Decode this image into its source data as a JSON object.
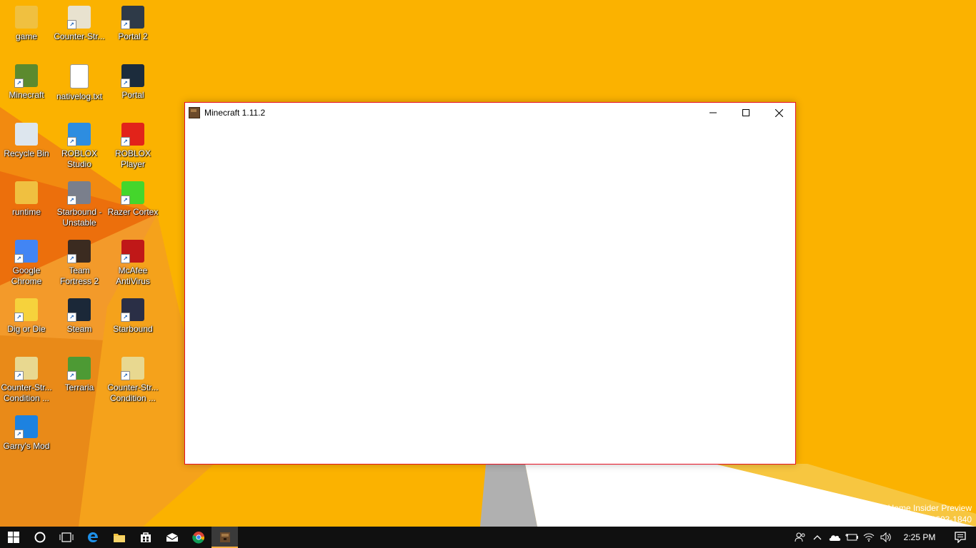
{
  "desktop": {
    "icons": [
      {
        "label": "game",
        "icon": "folder-icon",
        "color": "#f0c040"
      },
      {
        "label": "Counter-Str...",
        "icon": "counter-strike-icon",
        "color": "#e8e2cf"
      },
      {
        "label": "Portal 2",
        "icon": "portal2-icon",
        "color": "#2e3a48"
      },
      {
        "label": "Minecraft",
        "icon": "minecraft-icon",
        "color": "#5c8a2e"
      },
      {
        "label": "nativelog.txt",
        "icon": "text-file-icon",
        "color": "#ffffff"
      },
      {
        "label": "Portal",
        "icon": "portal-icon",
        "color": "#1c2c3c"
      },
      {
        "label": "Recycle Bin",
        "icon": "recycle-bin-icon",
        "color": "#dde6ee"
      },
      {
        "label": "ROBLOX Studio",
        "icon": "roblox-studio-icon",
        "color": "#2d8de0"
      },
      {
        "label": "ROBLOX Player",
        "icon": "roblox-player-icon",
        "color": "#e2231a"
      },
      {
        "label": "runtime",
        "icon": "folder-icon",
        "color": "#f0c040"
      },
      {
        "label": "Starbound - Unstable",
        "icon": "starbound-unstable-icon",
        "color": "#7a7f8c"
      },
      {
        "label": "Razer Cortex",
        "icon": "razer-cortex-icon",
        "color": "#44d62c"
      },
      {
        "label": "Google Chrome",
        "icon": "chrome-icon",
        "color": "#4285f4"
      },
      {
        "label": "Team Fortress 2",
        "icon": "team-fortress-2-icon",
        "color": "#3b2b20"
      },
      {
        "label": "McAfee AntiVirus",
        "icon": "mcafee-icon",
        "color": "#c01818"
      },
      {
        "label": "Dig or Die",
        "icon": "dig-or-die-icon",
        "color": "#f6d23c"
      },
      {
        "label": "Steam",
        "icon": "steam-icon",
        "color": "#1b2838"
      },
      {
        "label": "Starbound",
        "icon": "starbound-icon",
        "color": "#2a2f46"
      },
      {
        "label": "Counter-Str... Condition ...",
        "icon": "counter-strike-cz-icon",
        "color": "#e8d890"
      },
      {
        "label": "Terraria",
        "icon": "terraria-icon",
        "color": "#4d9a34"
      },
      {
        "label": "Counter-Str... Condition ...",
        "icon": "counter-strike-cz-icon",
        "color": "#e8d890"
      },
      {
        "label": "Garry's Mod",
        "icon": "garrys-mod-icon",
        "color": "#1d82e0"
      }
    ]
  },
  "window": {
    "title": "Minecraft 1.11.2",
    "minimize_icon": "minimize-icon",
    "maximize_icon": "maximize-icon",
    "close_icon": "close-icon",
    "border_color": "#e81123"
  },
  "watermark": {
    "line1": "Windows 10 Home Insider Preview",
    "line2": "uild 16215.rs_prerelease.170603-1840"
  },
  "taskbar": {
    "buttons": [
      {
        "icon": "start-icon"
      },
      {
        "icon": "cortana-icon"
      },
      {
        "icon": "task-view-icon"
      },
      {
        "icon": "edge-icon"
      },
      {
        "icon": "file-explorer-icon"
      },
      {
        "icon": "store-icon"
      },
      {
        "icon": "mail-icon"
      },
      {
        "icon": "chrome-icon"
      },
      {
        "icon": "minecraft-icon"
      }
    ],
    "tray": {
      "icons": [
        "people-icon",
        "chevron-up-icon",
        "onedrive-icon",
        "battery-icon",
        "wifi-icon",
        "volume-icon"
      ],
      "time": "2:25 PM",
      "action_center_icon": "action-center-icon"
    }
  },
  "colors": {
    "wallpaper_bg": "#fbb200",
    "accent": "#f6b042",
    "taskbar": "#101010"
  }
}
